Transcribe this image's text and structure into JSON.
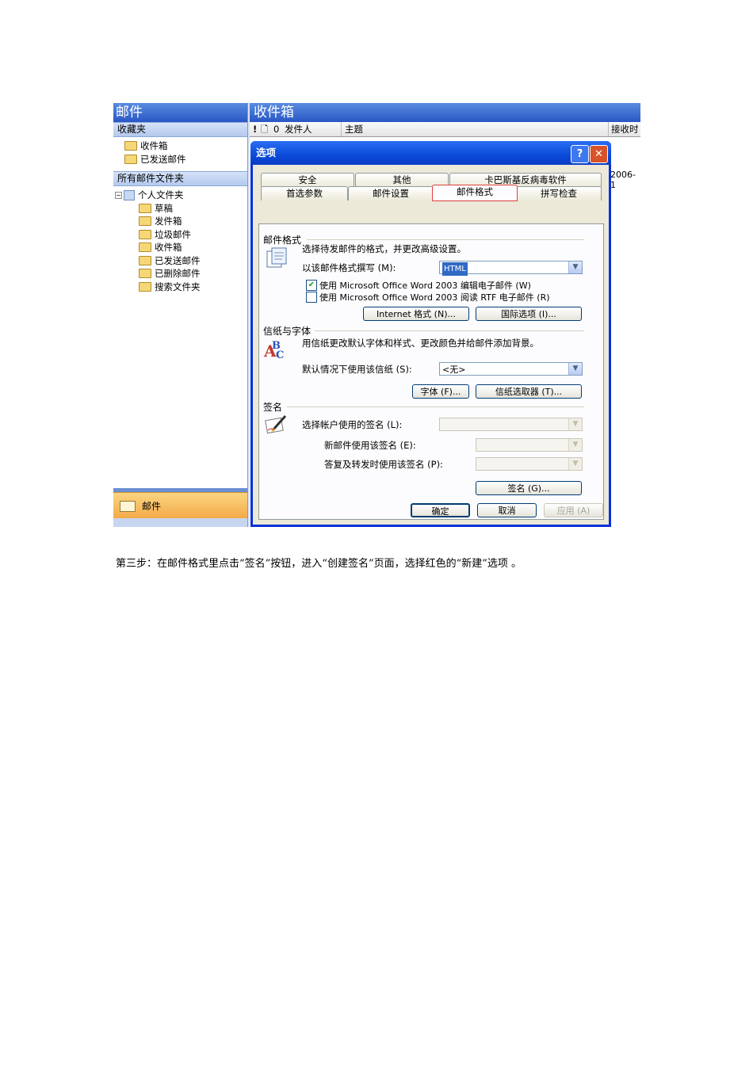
{
  "nav": {
    "title": "邮件",
    "favorites_header": "收藏夹",
    "favorites": [
      "收件箱",
      "已发送邮件"
    ],
    "all_folders_header": "所有邮件文件夹",
    "root": "个人文件夹",
    "folders": [
      "草稿",
      "发件箱",
      "垃圾邮件",
      "收件箱",
      "已发送邮件",
      "已删除邮件",
      "搜索文件夹"
    ],
    "mail_button": "邮件"
  },
  "inbox": {
    "title": "收件箱",
    "col_importance": "!",
    "col_icon": "🗋",
    "col_attach": "0",
    "col_from": "发件人",
    "col_subject": "主题",
    "col_received": "接收时",
    "row_date": "2006-1"
  },
  "dialog": {
    "title": "选项",
    "help": "?",
    "close": "✕",
    "tabs_row1": [
      "安全",
      "其他",
      "卡巴斯基反病毒软件"
    ],
    "tabs_row2": [
      "首选参数",
      "邮件设置",
      "邮件格式",
      "拼写检查"
    ],
    "active_tab": "邮件格式",
    "format": {
      "group": "邮件格式",
      "desc": "选择待发邮件的格式，并更改高级设置。",
      "compose_label": "以该邮件格式撰写 (M):",
      "compose_value": "HTML",
      "check1_label": "使用 Microsoft Office Word 2003 编辑电子邮件 (W)",
      "check1_checked": true,
      "check2_label": "使用 Microsoft Office Word 2003 阅读 RTF 电子邮件 (R)",
      "check2_checked": false,
      "internet_btn": "Internet 格式 (N)...",
      "intl_btn": "国际选项 (I)..."
    },
    "stationery": {
      "group": "信纸与字体",
      "desc": "用信纸更改默认字体和样式、更改颜色并给邮件添加背景。",
      "default_label": "默认情况下使用该信纸 (S):",
      "default_value": "<无>",
      "fonts_btn": "字体 (F)...",
      "picker_btn": "信纸选取器 (T)..."
    },
    "signature": {
      "group": "签名",
      "account_label": "选择帐户使用的签名 (L):",
      "new_label": "新邮件使用该签名 (E):",
      "reply_label": "答复及转发时使用该签名 (P):",
      "sign_btn": "签名 (G)..."
    },
    "ok": "确定",
    "cancel": "取消",
    "apply": "应用 (A)"
  },
  "caption": "第三步：在邮件格式里点击“签名”按钮，进入“创建签名”页面，选择红色的“新建”选项 。"
}
